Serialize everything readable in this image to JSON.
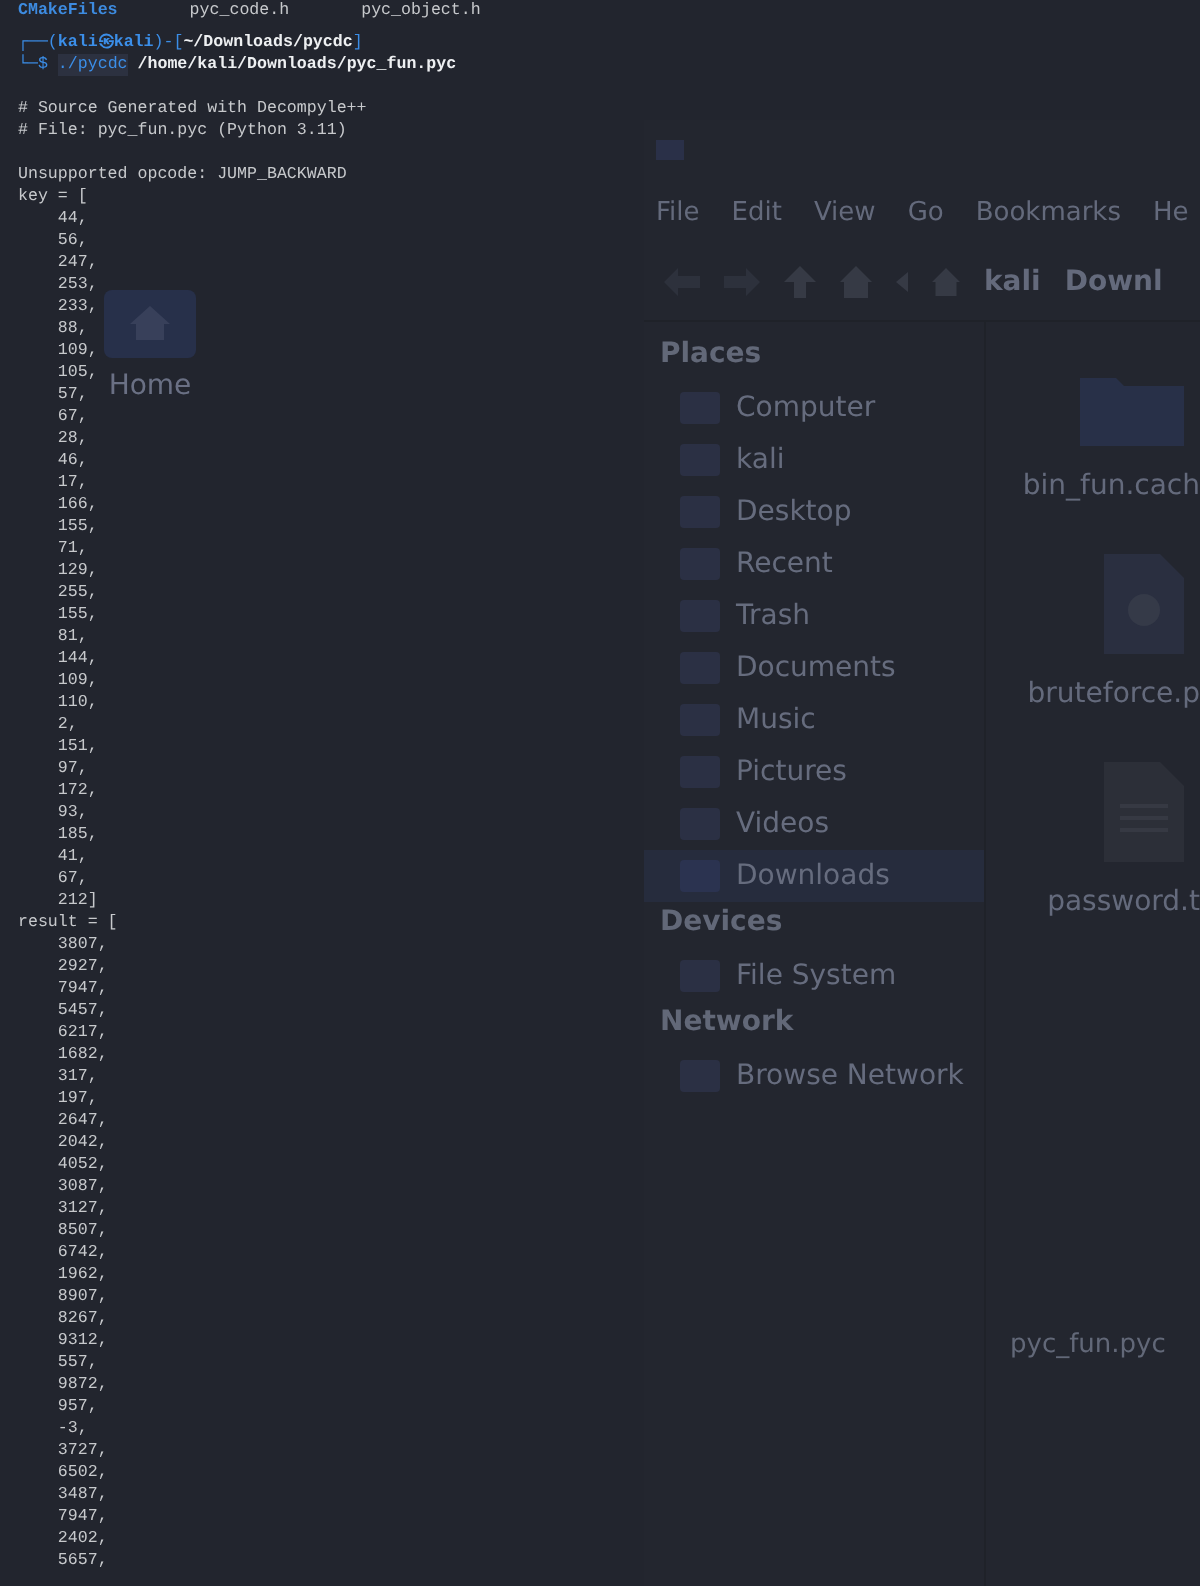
{
  "desktop": {
    "icons": [
      {
        "label": "Home"
      }
    ]
  },
  "file_manager": {
    "menu": [
      "File",
      "Edit",
      "View",
      "Go",
      "Bookmarks",
      "He"
    ],
    "path_bar": [
      "kali",
      "Downl"
    ],
    "sidebar": [
      {
        "heading": "Places",
        "items": [
          {
            "label": "Computer",
            "selected": false
          },
          {
            "label": "kali",
            "selected": false
          },
          {
            "label": "Desktop",
            "selected": false
          },
          {
            "label": "Recent",
            "selected": false
          },
          {
            "label": "Trash",
            "selected": false
          },
          {
            "label": "Documents",
            "selected": false
          },
          {
            "label": "Music",
            "selected": false
          },
          {
            "label": "Pictures",
            "selected": false
          },
          {
            "label": "Videos",
            "selected": false
          },
          {
            "label": "Downloads",
            "selected": true
          }
        ]
      },
      {
        "heading": "Devices",
        "items": [
          {
            "label": "File System",
            "selected": false
          }
        ]
      },
      {
        "heading": "Network",
        "items": [
          {
            "label": "Browse Network",
            "selected": false
          }
        ]
      }
    ],
    "files": [
      {
        "label": "bin_fun.cach",
        "kind": "folder"
      },
      {
        "label": "bruteforce.p",
        "kind": "python"
      },
      {
        "label": "password.t",
        "kind": "text"
      }
    ],
    "bottom_label": "pyc_fun.pyc"
  },
  "terminal": {
    "listing": [
      {
        "text": "CMakeFiles",
        "kind": "dir"
      },
      {
        "text": "pyc_code.h",
        "kind": "file"
      },
      {
        "text": "pyc_object.h",
        "kind": "file"
      }
    ],
    "prompt": {
      "open": "┌──(",
      "user": "kali",
      "at": "㉿",
      "host": "kali",
      "mid": ")-[",
      "path": "~/Downloads/pycdc",
      "close": "]",
      "symbol": "└─$",
      "command": "./pycdc",
      "argument": "/home/kali/Downloads/pyc_fun.pyc"
    },
    "header": [
      "# Source Generated with Decompyle++",
      "# File: pyc_fun.pyc (Python 3.11)"
    ],
    "output": [
      "Unsupported opcode: JUMP_BACKWARD",
      "key = [",
      "    44,",
      "    56,",
      "    247,",
      "    253,",
      "    233,",
      "    88,",
      "    109,",
      "    105,",
      "    57,",
      "    67,",
      "    28,",
      "    46,",
      "    17,",
      "    166,",
      "    155,",
      "    71,",
      "    129,",
      "    255,",
      "    155,",
      "    81,",
      "    144,",
      "    109,",
      "    110,",
      "    2,",
      "    151,",
      "    97,",
      "    172,",
      "    93,",
      "    185,",
      "    41,",
      "    67,",
      "    212]",
      "result = [",
      "    3807,",
      "    2927,",
      "    7947,",
      "    5457,",
      "    6217,",
      "    1682,",
      "    317,",
      "    197,",
      "    2647,",
      "    2042,",
      "    4052,",
      "    3087,",
      "    3127,",
      "    8507,",
      "    6742,",
      "    1962,",
      "    8907,",
      "    8267,",
      "    9312,",
      "    557,",
      "    9872,",
      "    957,",
      "    -3,",
      "    3727,",
      "    6502,",
      "    3487,",
      "    7947,",
      "    2402,",
      "    5657,"
    ]
  }
}
